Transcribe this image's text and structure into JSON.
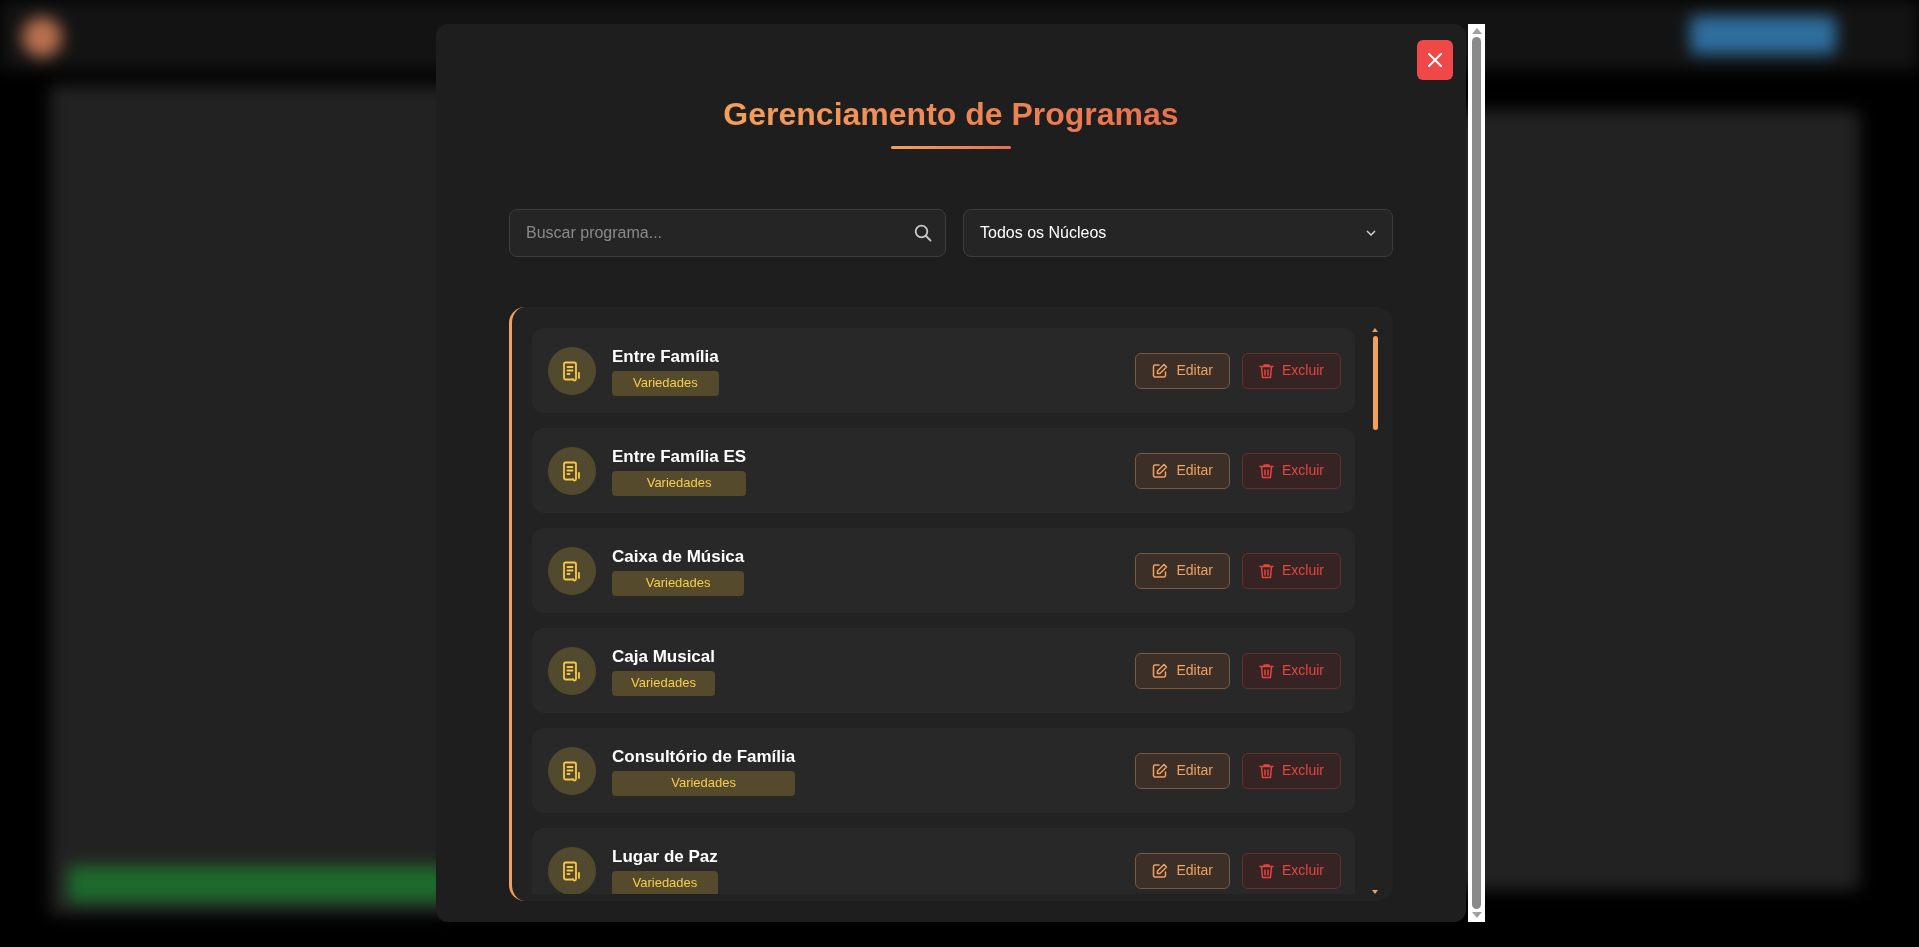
{
  "modal": {
    "title": "Gerenciamento de Programas",
    "search": {
      "placeholder": "Buscar programa..."
    },
    "filter": {
      "value": "Todos os Núcleos"
    },
    "programs": [
      {
        "name": "Entre Família",
        "category": "Variedades",
        "edit": "Editar",
        "delete": "Excluir"
      },
      {
        "name": "Entre Família ES",
        "category": "Variedades",
        "edit": "Editar",
        "delete": "Excluir"
      },
      {
        "name": "Caixa de Música",
        "category": "Variedades",
        "edit": "Editar",
        "delete": "Excluir"
      },
      {
        "name": "Caja Musical",
        "category": "Variedades",
        "edit": "Editar",
        "delete": "Excluir"
      },
      {
        "name": "Consultório de Família",
        "category": "Variedades",
        "edit": "Editar",
        "delete": "Excluir"
      },
      {
        "name": "Lugar de Paz",
        "category": "Variedades",
        "edit": "Editar",
        "delete": "Excluir"
      }
    ]
  }
}
